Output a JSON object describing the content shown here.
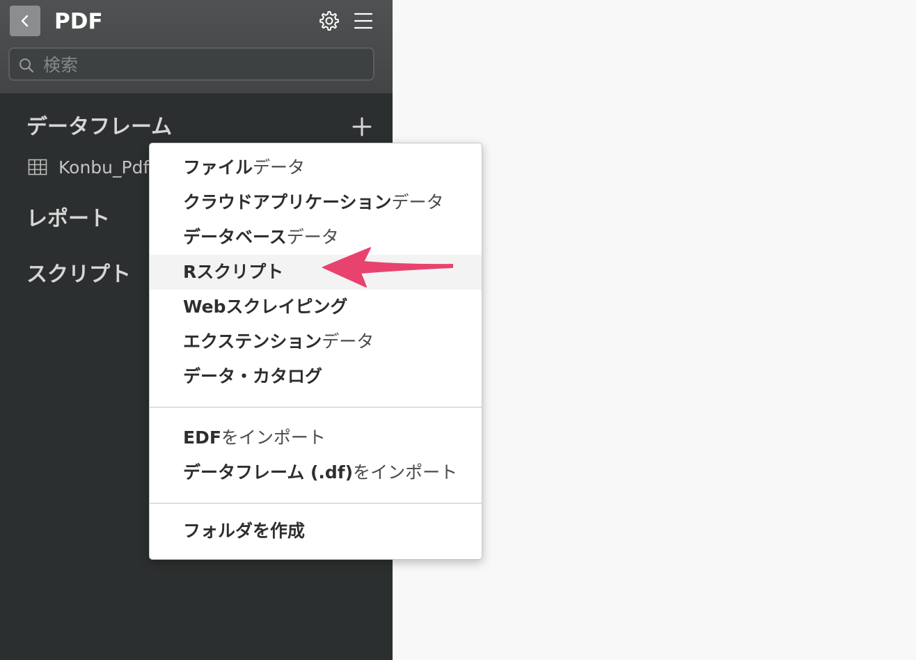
{
  "header": {
    "title": "PDF"
  },
  "search": {
    "placeholder": "検索"
  },
  "sidebar": {
    "sections": [
      {
        "label": "データフレーム"
      },
      {
        "label": "レポート"
      },
      {
        "label": "スクリプト"
      }
    ],
    "dataframe_item": "Konbu_Pdf"
  },
  "dropdown": {
    "items": [
      {
        "strong": "ファイル",
        "light": "データ"
      },
      {
        "strong": "クラウドアプリケーション",
        "light": "データ"
      },
      {
        "strong": "データベース",
        "light": "データ"
      },
      {
        "strong": "Rスクリプト",
        "light": ""
      },
      {
        "strong": "Webスクレイピング",
        "light": ""
      },
      {
        "strong": "エクステンション",
        "light": "データ"
      },
      {
        "strong": "データ・カタログ",
        "light": ""
      },
      {
        "strong": "EDF",
        "light": "をインポート"
      },
      {
        "strong": "データフレーム (.df)",
        "light": "をインポート"
      },
      {
        "strong": "フォルダを作成",
        "light": ""
      }
    ]
  },
  "colors": {
    "arrow": "#e8436e",
    "sidebar_bg": "#2c2f2f",
    "header_bg": "#484a4b"
  }
}
